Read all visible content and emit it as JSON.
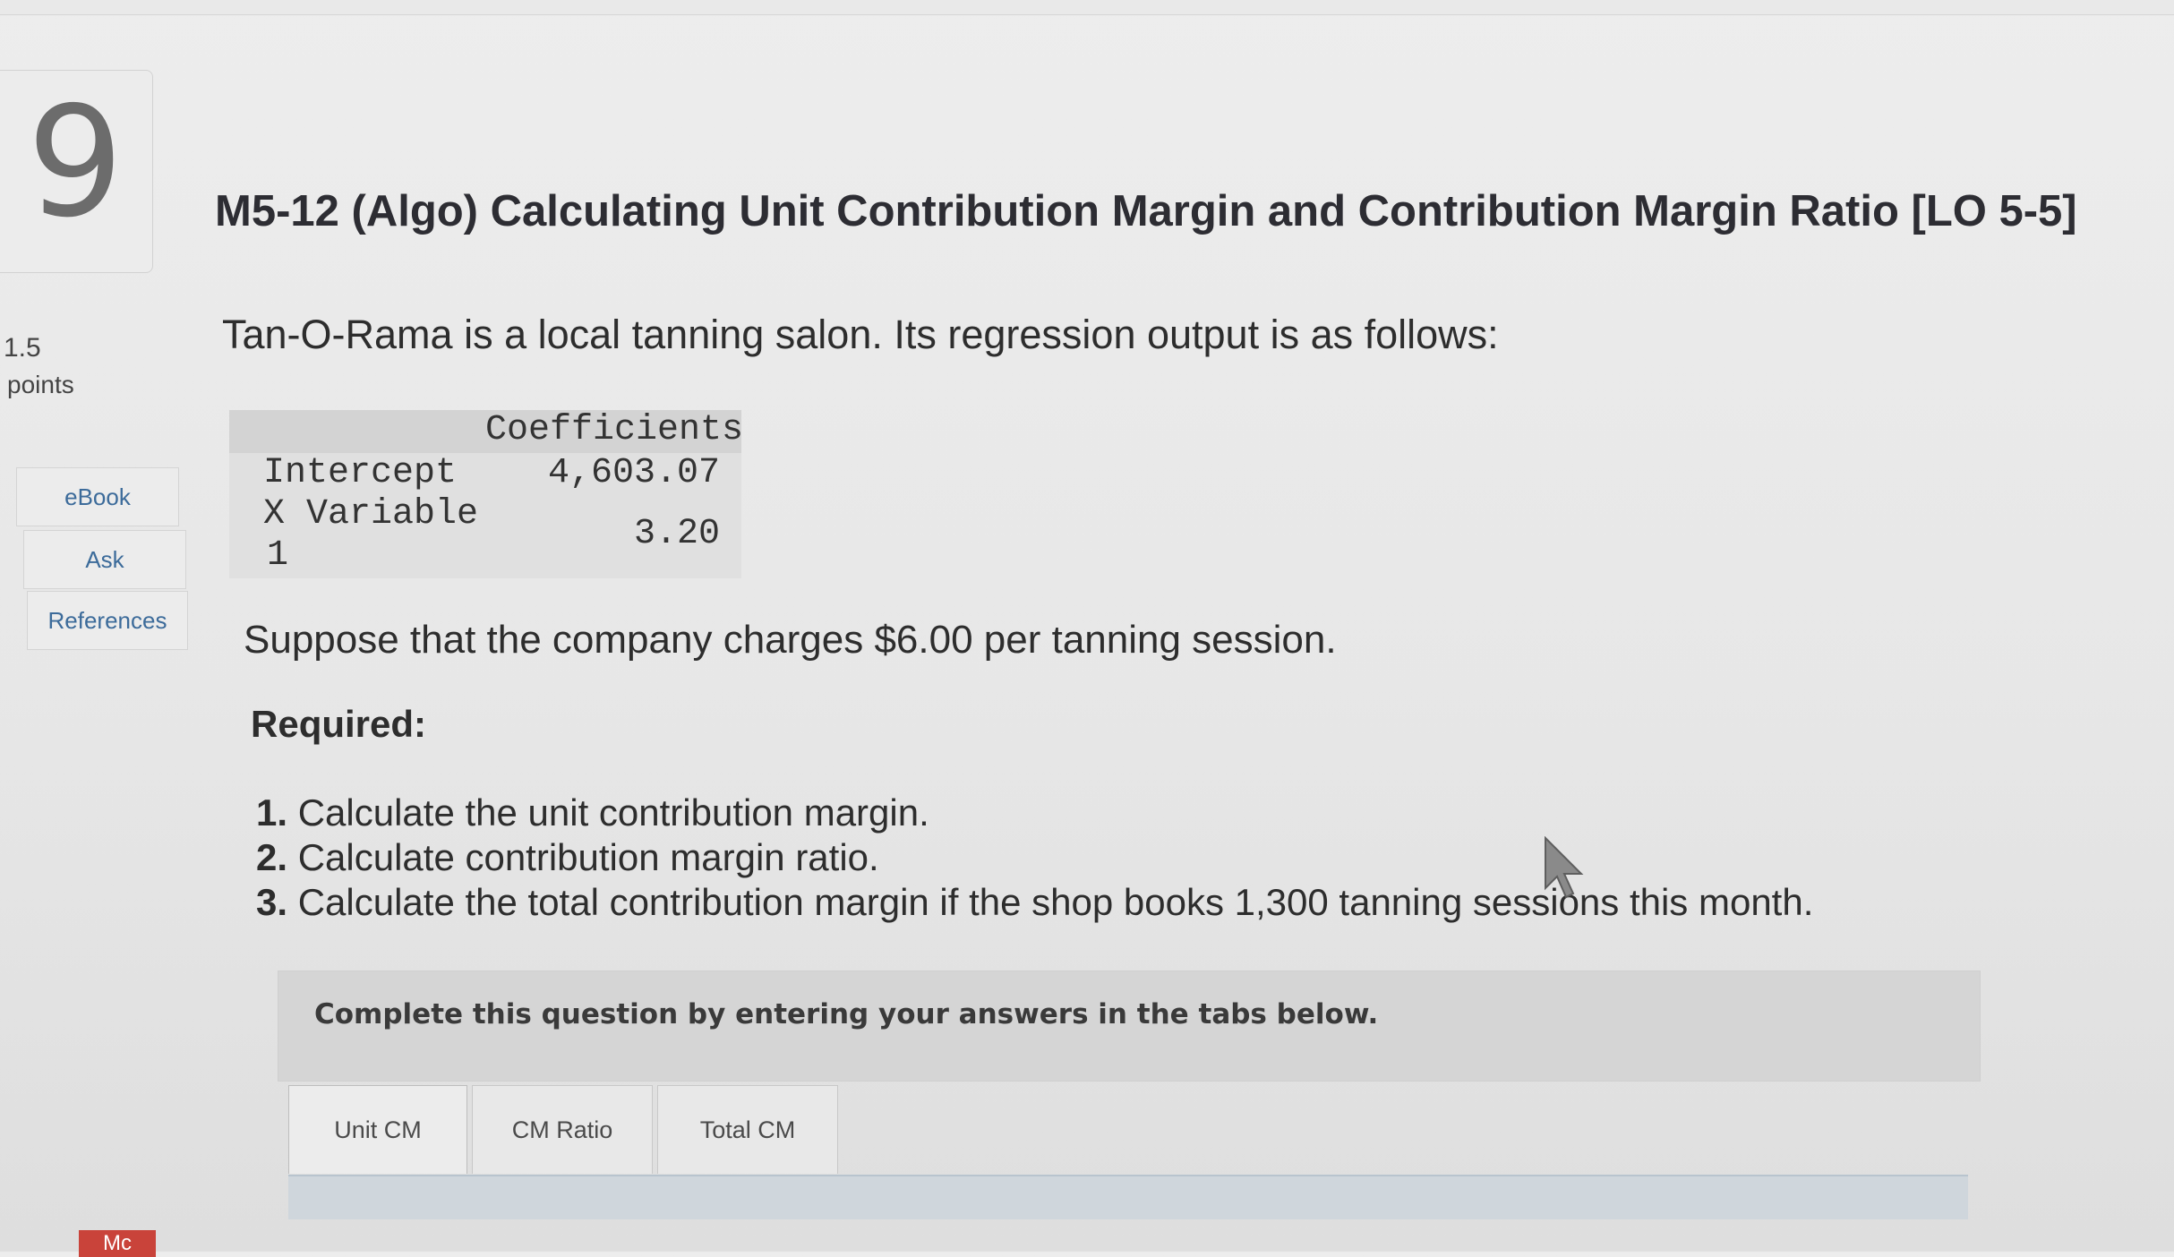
{
  "question": {
    "number": "9",
    "points_value": "1.5",
    "points_label": "points",
    "title": "M5-12 (Algo) Calculating Unit Contribution Margin and Contribution Margin Ratio [LO 5-5]"
  },
  "sidebar": {
    "ebook": "eBook",
    "ask": "Ask",
    "references": "References"
  },
  "body": {
    "intro": "Tan-O-Rama is a local tanning salon. Its regression output is as follows:",
    "regression": {
      "header": "Coefficients",
      "rows": [
        {
          "label": "Intercept",
          "value": "4,603.07"
        },
        {
          "label_line1": "X Variable",
          "label_line2": "1",
          "value": "3.20"
        }
      ]
    },
    "suppose": "Suppose that the company charges $6.00 per tanning session.",
    "required_label": "Required:",
    "requirements": [
      {
        "num": "1.",
        "text": "Calculate the unit contribution margin."
      },
      {
        "num": "2.",
        "text": "Calculate contribution margin ratio."
      },
      {
        "num": "3.",
        "text": "Calculate the total contribution margin if the shop books 1,300 tanning sessions this month."
      }
    ]
  },
  "instructions": "Complete this question by entering your answers in the tabs below.",
  "tabs": [
    "Unit CM",
    "CM Ratio",
    "Total CM"
  ],
  "badge": "Mc"
}
